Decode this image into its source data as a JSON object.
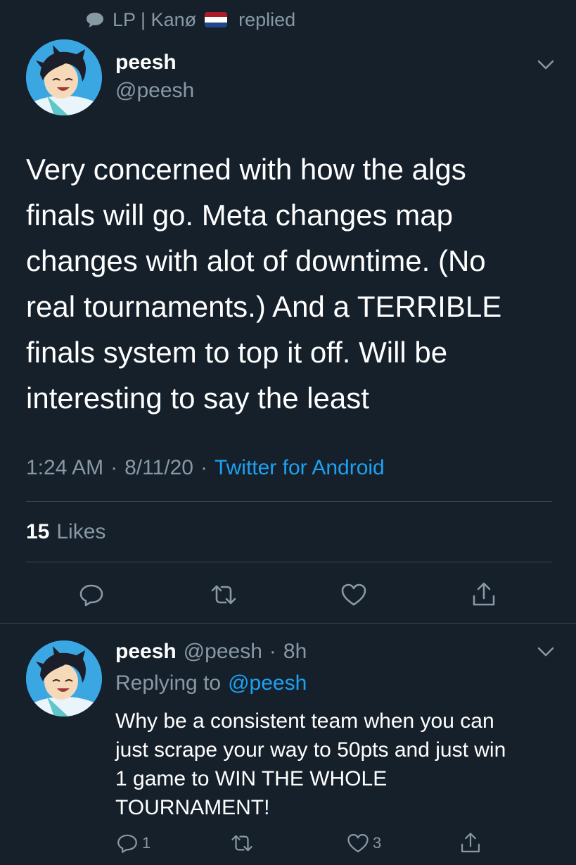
{
  "context": {
    "actor": "LP | Kanø",
    "action": "replied",
    "icon": "speech-bubble-icon",
    "flag": {
      "icon": "netherlands-flag-icon",
      "colors": [
        "#ae1c28",
        "#ffffff",
        "#21468b"
      ]
    }
  },
  "main_tweet": {
    "display_name": "peesh",
    "handle": "@peesh",
    "text": "Very concerned with how the algs\nfinals will go. Meta changes map\nchanges with alot of downtime. (No\nreal tournaments.) And a TERRIBLE\nfinals system to top it off. Will be\ninteresting to say the least",
    "time": "1:24 AM",
    "date": "8/11/20",
    "separator": "·",
    "source": "Twitter for Android",
    "likes_count": "15",
    "likes_label": "Likes",
    "actions": [
      "reply-icon",
      "retweet-icon",
      "like-icon",
      "share-icon"
    ]
  },
  "reply_tweet": {
    "display_name": "peesh",
    "handle": "@peesh",
    "separator": "·",
    "time": "8h",
    "replying_label": "Replying to",
    "replying_to": "@peesh",
    "text": "Why be a consistent team when you can\njust scrape your way to 50pts and just win\n1 game to WIN THE WHOLE\nTOURNAMENT!",
    "reply_count": "1",
    "like_count": "3"
  },
  "colors": {
    "background": "#15202b",
    "text": "#ffffff",
    "secondary": "#8899a6",
    "accent": "#1da1f2",
    "divider": "#38444d"
  }
}
